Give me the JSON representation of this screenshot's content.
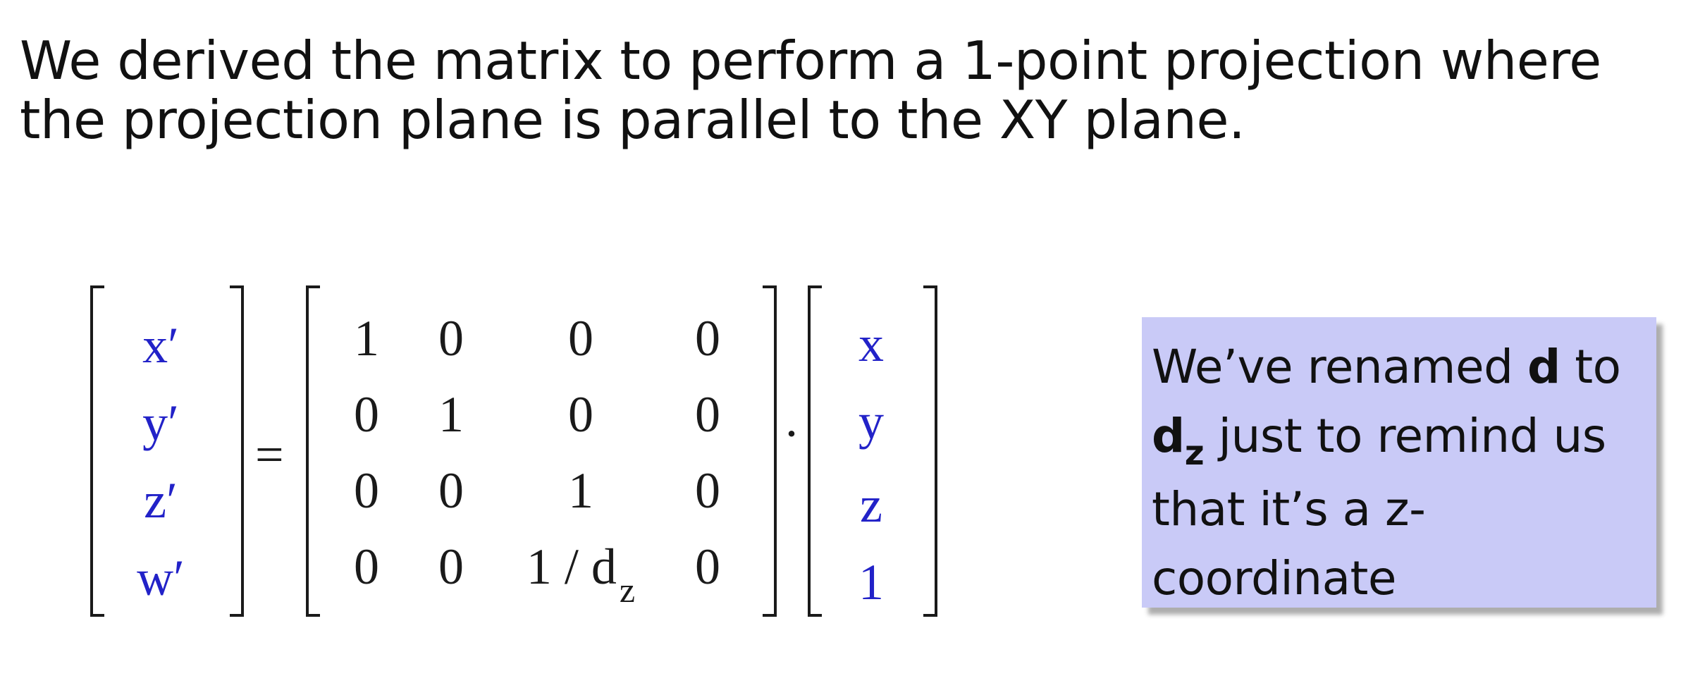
{
  "intro": {
    "text": "We derived the matrix to perform a 1-point projection where the projection plane is parallel to the XY plane."
  },
  "equation": {
    "lhs": [
      "x′",
      "y′",
      "z′",
      "w′"
    ],
    "equals": "=",
    "dot": "·",
    "matrix": [
      [
        "1",
        "0",
        "0",
        "0"
      ],
      [
        "0",
        "1",
        "0",
        "0"
      ],
      [
        "0",
        "0",
        "1",
        "0"
      ],
      [
        "0",
        "0",
        "1 / d",
        "0"
      ]
    ],
    "matrix_sub": "z",
    "rhs": [
      "x",
      "y",
      "z",
      "1"
    ]
  },
  "callout": {
    "part1": "We’ve renamed ",
    "bold_d": "d",
    "part2": " to",
    "bold_dz": "d",
    "bold_dz_sub": "z",
    "part3": " just to remind us that it’s a z-coordinate"
  },
  "colors": {
    "vector_text": "#2222c8",
    "matrix_text": "#1a1a1a",
    "callout_bg": "#c9caf7"
  }
}
